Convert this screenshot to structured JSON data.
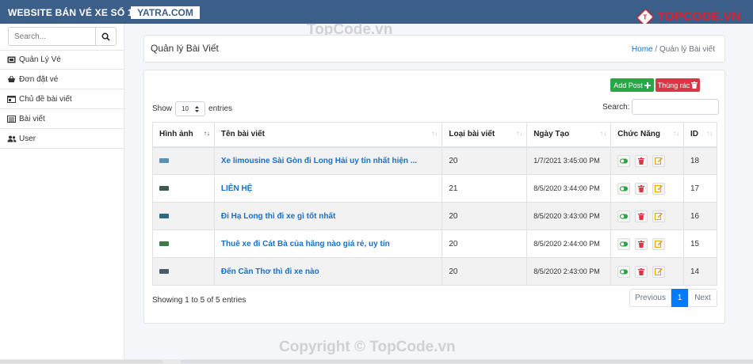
{
  "header": {
    "brand": "WEBSITE BÁN VÉ XE SỐ 1",
    "domain": "YATRA.COM",
    "logo_text": "TOPCODE.VN",
    "logo_mark": "T"
  },
  "sidebar": {
    "search_placeholder": "Search...",
    "items": [
      {
        "label": "Quản Lý Vé",
        "icon": "ticket-icon"
      },
      {
        "label": "Đơn đặt vé",
        "icon": "basket-icon"
      },
      {
        "label": "Chủ đề bài viết",
        "icon": "folder-icon"
      },
      {
        "label": "Bài viết",
        "icon": "newspaper-icon"
      },
      {
        "label": "User",
        "icon": "users-icon"
      }
    ]
  },
  "page": {
    "title": "Quản lý Bài Viết",
    "breadcrumb_home": "Home",
    "breadcrumb_sep": "/",
    "breadcrumb_current": "Quản lý Bài viết"
  },
  "toolbar": {
    "add_label": "Add Post",
    "trash_label": "Thùng rác"
  },
  "table_controls": {
    "show_label": "Show",
    "entries_value": "10",
    "entries_label": "entries",
    "search_label": "Search:"
  },
  "table": {
    "columns": [
      "Hình ảnh",
      "Tên bài viết",
      "Loại bài viết",
      "Ngày Tạo",
      "Chức Năng",
      "ID"
    ],
    "rows": [
      {
        "title": "Xe limousine Sài Gòn đi Long Hải uy tín nhất hiện ...",
        "type": "20",
        "date": "1/7/2021 3:45:00 PM",
        "id": "18",
        "thumb": "#5a8fb8"
      },
      {
        "title": "LIÊN HỆ",
        "type": "21",
        "date": "8/5/2020 3:44:00 PM",
        "id": "17",
        "thumb": "#3d5a4f"
      },
      {
        "title": "Đi Hạ Long thì đi xe gì tốt nhất",
        "type": "20",
        "date": "8/5/2020 3:43:00 PM",
        "id": "16",
        "thumb": "#2d6a8a"
      },
      {
        "title": "Thuê xe đi Cát Bà của hãng nào giá rẻ, uy tín",
        "type": "20",
        "date": "8/5/2020 2:44:00 PM",
        "id": "15",
        "thumb": "#3b7a4a"
      },
      {
        "title": "Đến Cần Thơ thì đi xe nào",
        "type": "20",
        "date": "8/5/2020 2:43:00 PM",
        "id": "14",
        "thumb": "#4a5a70"
      }
    ]
  },
  "footer": {
    "info": "Showing 1 to 5 of 5 entries",
    "prev": "Previous",
    "page": "1",
    "next": "Next"
  },
  "watermarks": {
    "top": "TopCode.vn",
    "bottom": "Copyright © TopCode.vn"
  },
  "colors": {
    "header": "#3c5f8a",
    "link": "#1a6fc4",
    "success": "#28a745",
    "danger": "#dc3545",
    "primary": "#007bff"
  }
}
